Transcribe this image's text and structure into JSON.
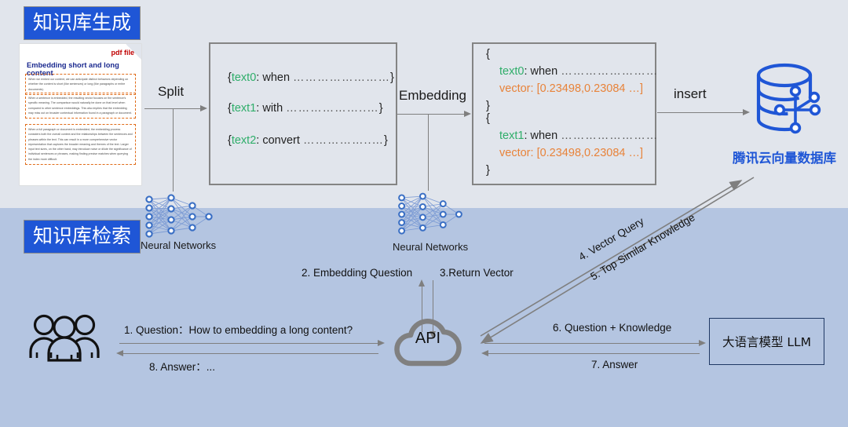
{
  "colors": {
    "band_top": "#e1e5ec",
    "band_bottom": "#b4c5e1",
    "chip_bg": "#1f56d6",
    "chip_text": "#ffffff",
    "box_border": "#848484",
    "arrow": "#7f7f7f",
    "key_green": "#2fae6a",
    "key_orange": "#e8833a",
    "brand_blue": "#1f56d6",
    "pdf_title": "#1b2a8f",
    "pdf_accent": "#c00000",
    "pdf_dash": "#e06c1a"
  },
  "sections": {
    "generation_chip": "知识库生成",
    "retrieval_chip": "知识库检索"
  },
  "pdf_doc": {
    "file_type_label": "pdf file",
    "title": "Embedding short and long content",
    "paragraphs": [
      "When we embed our content, we can anticipate distinct behaviors depending on whether the content is short (like sentences) or long (like paragraphs or entire documents).",
      "When a sentence is embedded, the resulting vector focuses on the sentence's specific meaning. The comparison would naturally be done on that level when compared to other sentence embeddings. This also implies that the embedding may miss out on broader contextual information found in a paragraph or document.",
      "When a full paragraph or document is embedded, the embedding process considers both the overall context and the relationships between the sentences and phrases within the text. This can result in a more comprehensive vector representation that captures the broader meaning and themes of the text. Larger input text sizes, on the other hand, may introduce noise or dilute the significance of individual sentences or phrases, making finding precise matches when querying the index more difficult."
    ]
  },
  "flow_labels": {
    "split": "Split",
    "embedding": "Embedding",
    "insert": "insert"
  },
  "chunks_box": {
    "lines": [
      {
        "open": "{",
        "key": "text0",
        "colon": ": ",
        "value": "when",
        "dots": "……………………",
        "close": "}"
      },
      {
        "open": "{",
        "key": "text1",
        "colon": ": ",
        "value": "with",
        "dots": "………………..…",
        "close": "}"
      },
      {
        "open": "{",
        "key": "text2",
        "colon": ": ",
        "value": "convert",
        "dots": "……………..…",
        "close": "}"
      }
    ]
  },
  "vectors_box": {
    "records": [
      {
        "open": "{",
        "text_key": "text0",
        "text_value": "when",
        "text_dots": "……………………",
        "vector_key": "vector",
        "vector_value": "[0.23498,0.23084 …]",
        "close": "}"
      },
      {
        "open": "{",
        "text_key": "text1",
        "text_value": "when",
        "text_dots": "……………………",
        "vector_key": "vector",
        "vector_value": "[0.23498,0.23084 …]",
        "close": "}"
      }
    ]
  },
  "database": {
    "label": "腾讯云向量数据库"
  },
  "neural_networks": {
    "left_caption": "Neural Networks",
    "middle_caption": "Neural Networks"
  },
  "api": {
    "label": "API"
  },
  "llm": {
    "label": "大语言模型 LLM"
  },
  "steps": {
    "s1": "1. Question：How to embedding a long content?",
    "s2": "2. Embedding Question",
    "s3": "3.Return Vector",
    "s4": "4. Vector Query",
    "s5": "5. Top Similar Knowledge",
    "s6": "6. Question + Knowledge",
    "s7": "7. Answer",
    "s8": "8. Answer：..."
  }
}
